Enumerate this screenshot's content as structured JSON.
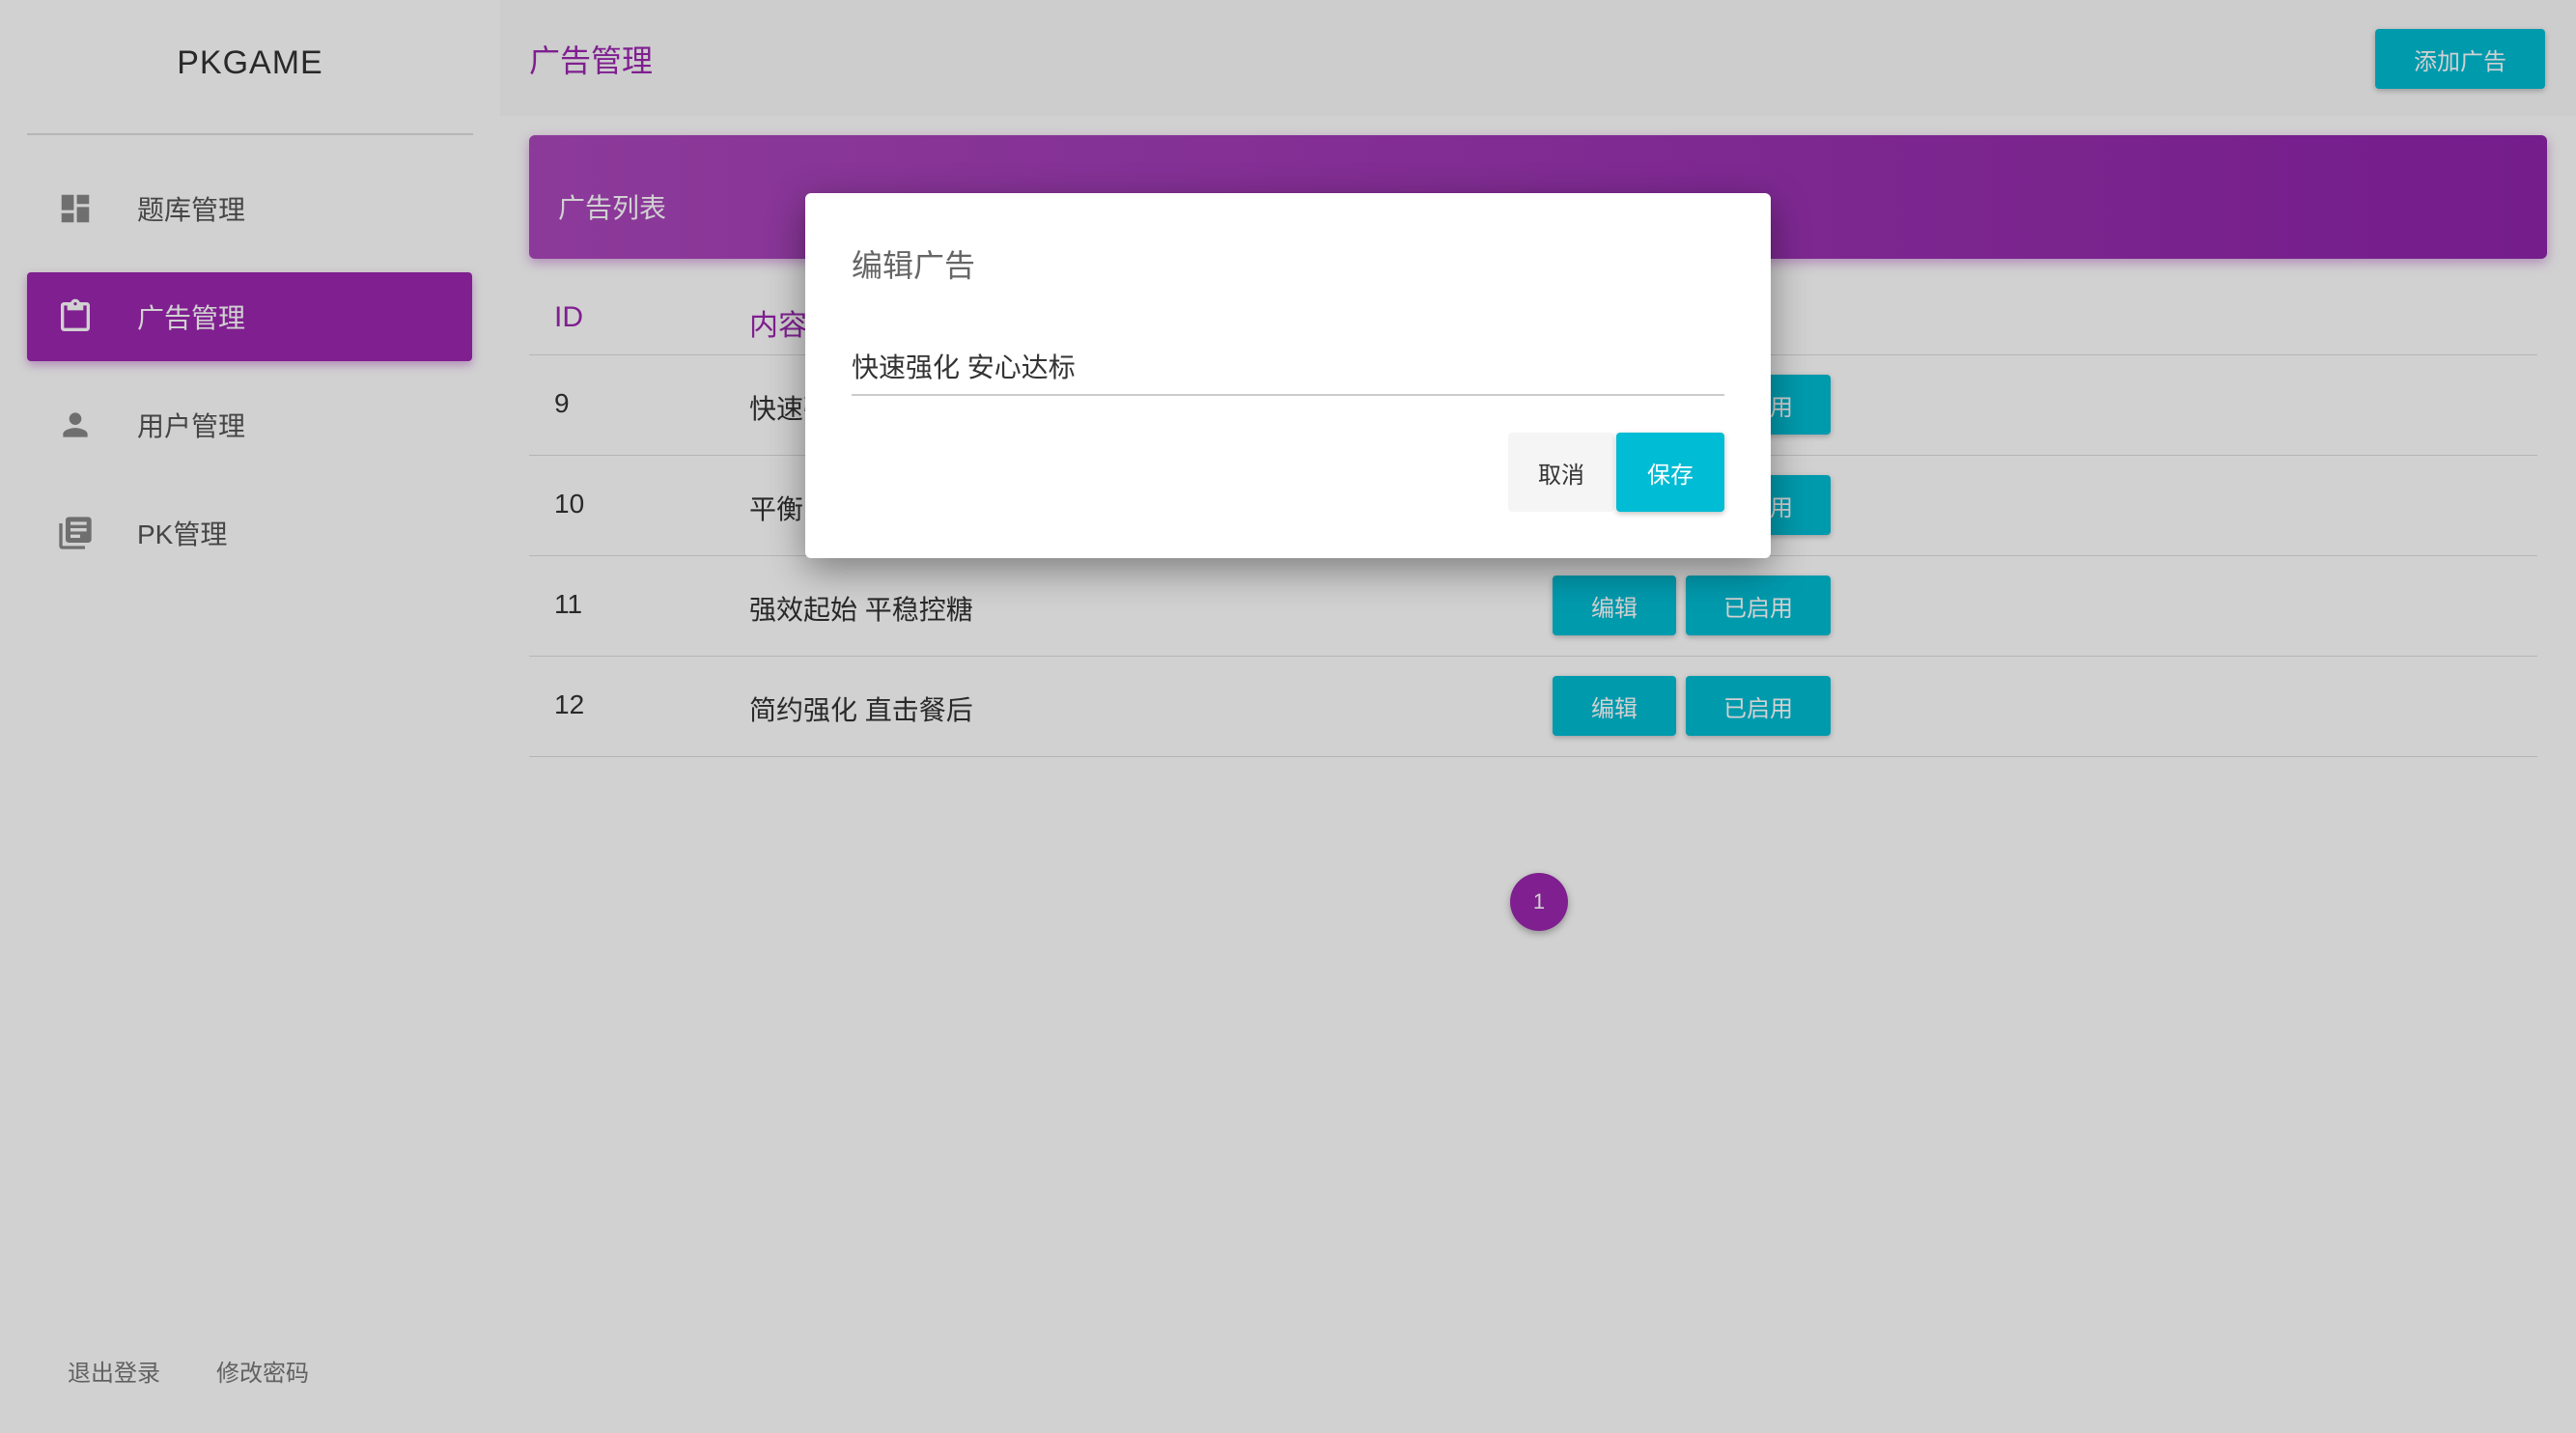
{
  "app": {
    "logo": "PKGAME"
  },
  "sidebar": {
    "items": [
      {
        "label": "题库管理",
        "icon": "dashboard-icon",
        "active": false
      },
      {
        "label": "广告管理",
        "icon": "clipboard-icon",
        "active": true
      },
      {
        "label": "用户管理",
        "icon": "person-icon",
        "active": false
      },
      {
        "label": "PK管理",
        "icon": "library-books-icon",
        "active": false
      }
    ],
    "footer": {
      "logout": "退出登录",
      "change_password": "修改密码"
    }
  },
  "header": {
    "title": "广告管理",
    "add_button": "添加广告"
  },
  "card": {
    "title": "广告列表"
  },
  "table": {
    "headers": {
      "id": "ID",
      "content": "内容"
    },
    "rows": [
      {
        "id": "9",
        "content": "快速强化 安心达标",
        "edit": "编辑",
        "status": "已启用"
      },
      {
        "id": "10",
        "content": "平衡",
        "edit": "编辑",
        "status": "已启用"
      },
      {
        "id": "11",
        "content": "强效起始 平稳控糖",
        "edit": "编辑",
        "status": "已启用"
      },
      {
        "id": "12",
        "content": "简约强化 直击餐后",
        "edit": "编辑",
        "status": "已启用"
      }
    ]
  },
  "pagination": {
    "current": "1"
  },
  "dialog": {
    "title": "编辑广告",
    "input_value": "快速强化 安心达标",
    "cancel": "取消",
    "save": "保存"
  },
  "colors": {
    "primary": "#9c27b0",
    "accent": "#00bcd4"
  }
}
